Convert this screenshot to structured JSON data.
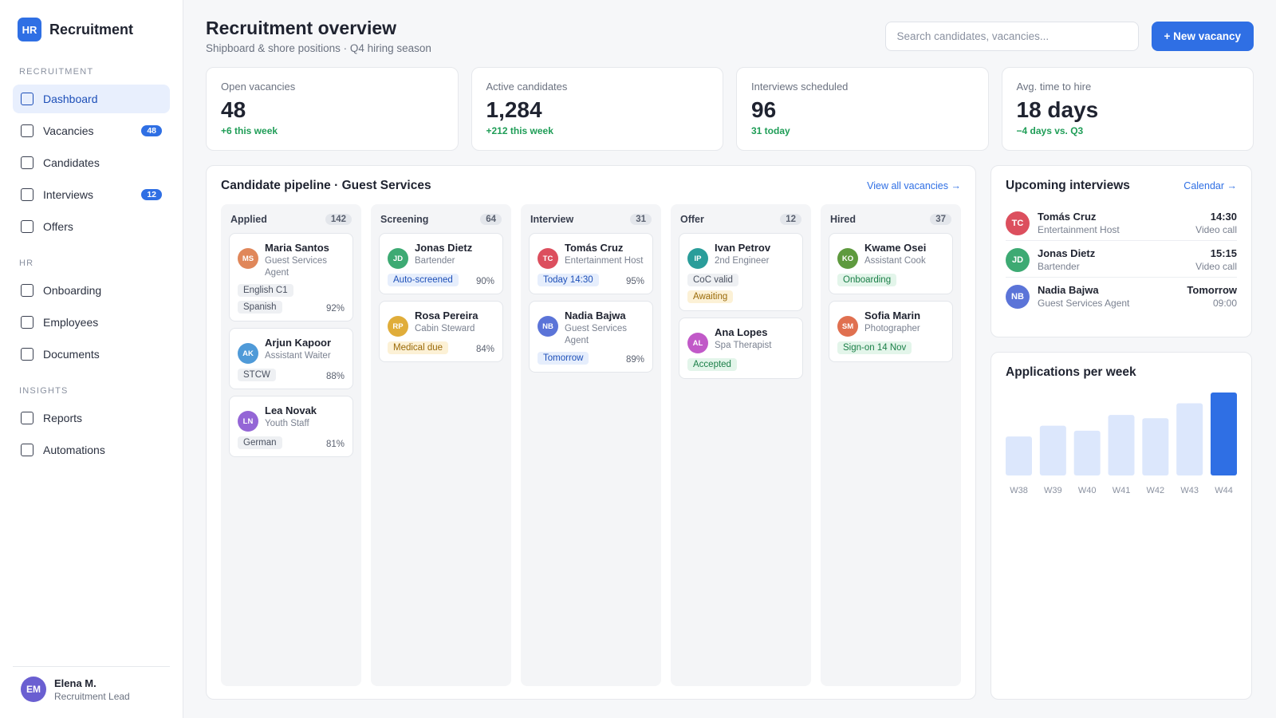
{
  "brand": {
    "logo": "HR",
    "name": "Recruitment"
  },
  "nav": {
    "sections": [
      {
        "title": "RECRUITMENT",
        "items": [
          {
            "label": "Dashboard",
            "badge": "",
            "active": true
          },
          {
            "label": "Vacancies",
            "badge": "48"
          },
          {
            "label": "Candidates",
            "badge": ""
          },
          {
            "label": "Interviews",
            "badge": "12"
          },
          {
            "label": "Offers",
            "badge": ""
          }
        ]
      },
      {
        "title": "HR",
        "items": [
          {
            "label": "Onboarding",
            "badge": ""
          },
          {
            "label": "Employees",
            "badge": ""
          },
          {
            "label": "Documents",
            "badge": ""
          }
        ]
      },
      {
        "title": "INSIGHTS",
        "items": [
          {
            "label": "Reports",
            "badge": ""
          },
          {
            "label": "Automations",
            "badge": ""
          }
        ]
      }
    ]
  },
  "profile": {
    "initials": "EM",
    "name": "Elena M.",
    "role": "Recruitment Lead"
  },
  "header": {
    "title": "Recruitment overview",
    "subtitle": "Shipboard & shore positions · Q4 hiring season",
    "search_placeholder": "Search candidates, vacancies...",
    "new_button": "+ New vacancy"
  },
  "stats": [
    {
      "label": "Open vacancies",
      "value": "48",
      "delta": "+6 this week"
    },
    {
      "label": "Active candidates",
      "value": "1,284",
      "delta": "+212 this week"
    },
    {
      "label": "Interviews scheduled",
      "value": "96",
      "delta": "31 today"
    },
    {
      "label": "Avg. time to hire",
      "value": "18 days",
      "delta": "−4 days vs. Q3"
    }
  ],
  "pipeline": {
    "title": "Candidate pipeline · Guest Services",
    "link": "View all vacancies →",
    "columns": [
      {
        "title": "Applied",
        "count": "142",
        "cards": [
          {
            "initials": "MS",
            "color": "#e0875a",
            "name": "Maria Santos",
            "role": "Guest Services Agent",
            "tags": [
              {
                "text": "English C1",
                "tone": "gray"
              },
              {
                "text": "Spanish",
                "tone": "gray"
              }
            ],
            "pct": "92%"
          },
          {
            "initials": "AK",
            "color": "#4f9ad8",
            "name": "Arjun Kapoor",
            "role": "Assistant Waiter",
            "tags": [
              {
                "text": "STCW",
                "tone": "gray"
              }
            ],
            "pct": "88%"
          },
          {
            "initials": "LN",
            "color": "#9466d6",
            "name": "Lea Novak",
            "role": "Youth Staff",
            "tags": [
              {
                "text": "German",
                "tone": "gray"
              }
            ],
            "pct": "81%"
          }
        ]
      },
      {
        "title": "Screening",
        "count": "64",
        "cards": [
          {
            "initials": "JD",
            "color": "#3daa73",
            "name": "Jonas Dietz",
            "role": "Bartender",
            "tags": [
              {
                "text": "Auto-screened",
                "tone": "blue"
              }
            ],
            "pct": "90%"
          },
          {
            "initials": "RP",
            "color": "#e0ad3a",
            "name": "Rosa Pereira",
            "role": "Cabin Steward",
            "tags": [
              {
                "text": "Medical due",
                "tone": "amber"
              }
            ],
            "pct": "84%"
          }
        ]
      },
      {
        "title": "Interview",
        "count": "31",
        "cards": [
          {
            "initials": "TC",
            "color": "#dc4f5e",
            "name": "Tomás Cruz",
            "role": "Entertainment Host",
            "tags": [
              {
                "text": "Today 14:30",
                "tone": "blue"
              }
            ],
            "pct": "95%"
          },
          {
            "initials": "NB",
            "color": "#5b74d8",
            "name": "Nadia Bajwa",
            "role": "Guest Services Agent",
            "tags": [
              {
                "text": "Tomorrow",
                "tone": "blue"
              }
            ],
            "pct": "89%"
          }
        ]
      },
      {
        "title": "Offer",
        "count": "12",
        "cards": [
          {
            "initials": "IP",
            "color": "#2a9d9a",
            "name": "Ivan Petrov",
            "role": "2nd Engineer",
            "tags": [
              {
                "text": "CoC valid",
                "tone": "gray"
              },
              {
                "text": "Awaiting",
                "tone": "amber"
              }
            ],
            "pct": ""
          },
          {
            "initials": "AL",
            "color": "#c159c8",
            "name": "Ana Lopes",
            "role": "Spa Therapist",
            "tags": [
              {
                "text": "Accepted",
                "tone": "green"
              }
            ],
            "pct": ""
          }
        ]
      },
      {
        "title": "Hired",
        "count": "37",
        "cards": [
          {
            "initials": "KO",
            "color": "#5e9a3e",
            "name": "Kwame Osei",
            "role": "Assistant Cook",
            "tags": [
              {
                "text": "Onboarding",
                "tone": "green"
              }
            ],
            "pct": ""
          },
          {
            "initials": "SM",
            "color": "#e07050",
            "name": "Sofia Marin",
            "role": "Photographer",
            "tags": [
              {
                "text": "Sign-on 14 Nov",
                "tone": "green"
              }
            ],
            "pct": ""
          }
        ]
      }
    ]
  },
  "upcoming": {
    "title": "Upcoming interviews",
    "link": "Calendar →",
    "items": [
      {
        "initials": "TC",
        "color": "#dc4f5e",
        "name": "Tomás Cruz",
        "role": "Entertainment Host",
        "time": "14:30",
        "type": "Video call"
      },
      {
        "initials": "JD",
        "color": "#3daa73",
        "name": "Jonas Dietz",
        "role": "Bartender",
        "time": "15:15",
        "type": "Video call"
      },
      {
        "initials": "NB",
        "color": "#5b74d8",
        "name": "Nadia Bajwa",
        "role": "Guest Services Agent",
        "time": "Tomorrow",
        "type": "09:00"
      }
    ]
  },
  "applications": {
    "title": "Applications per week",
    "chart_data": {
      "type": "bar",
      "categories": [
        "W38",
        "W39",
        "W40",
        "W41",
        "W42",
        "W43",
        "W44"
      ],
      "values": [
        47,
        60,
        54,
        73,
        69,
        87,
        100
      ],
      "ylim": [
        0,
        100
      ],
      "highlight_index": 6,
      "colors": {
        "bar": "#dce7fc",
        "highlight": "#2f6fe4"
      }
    }
  }
}
